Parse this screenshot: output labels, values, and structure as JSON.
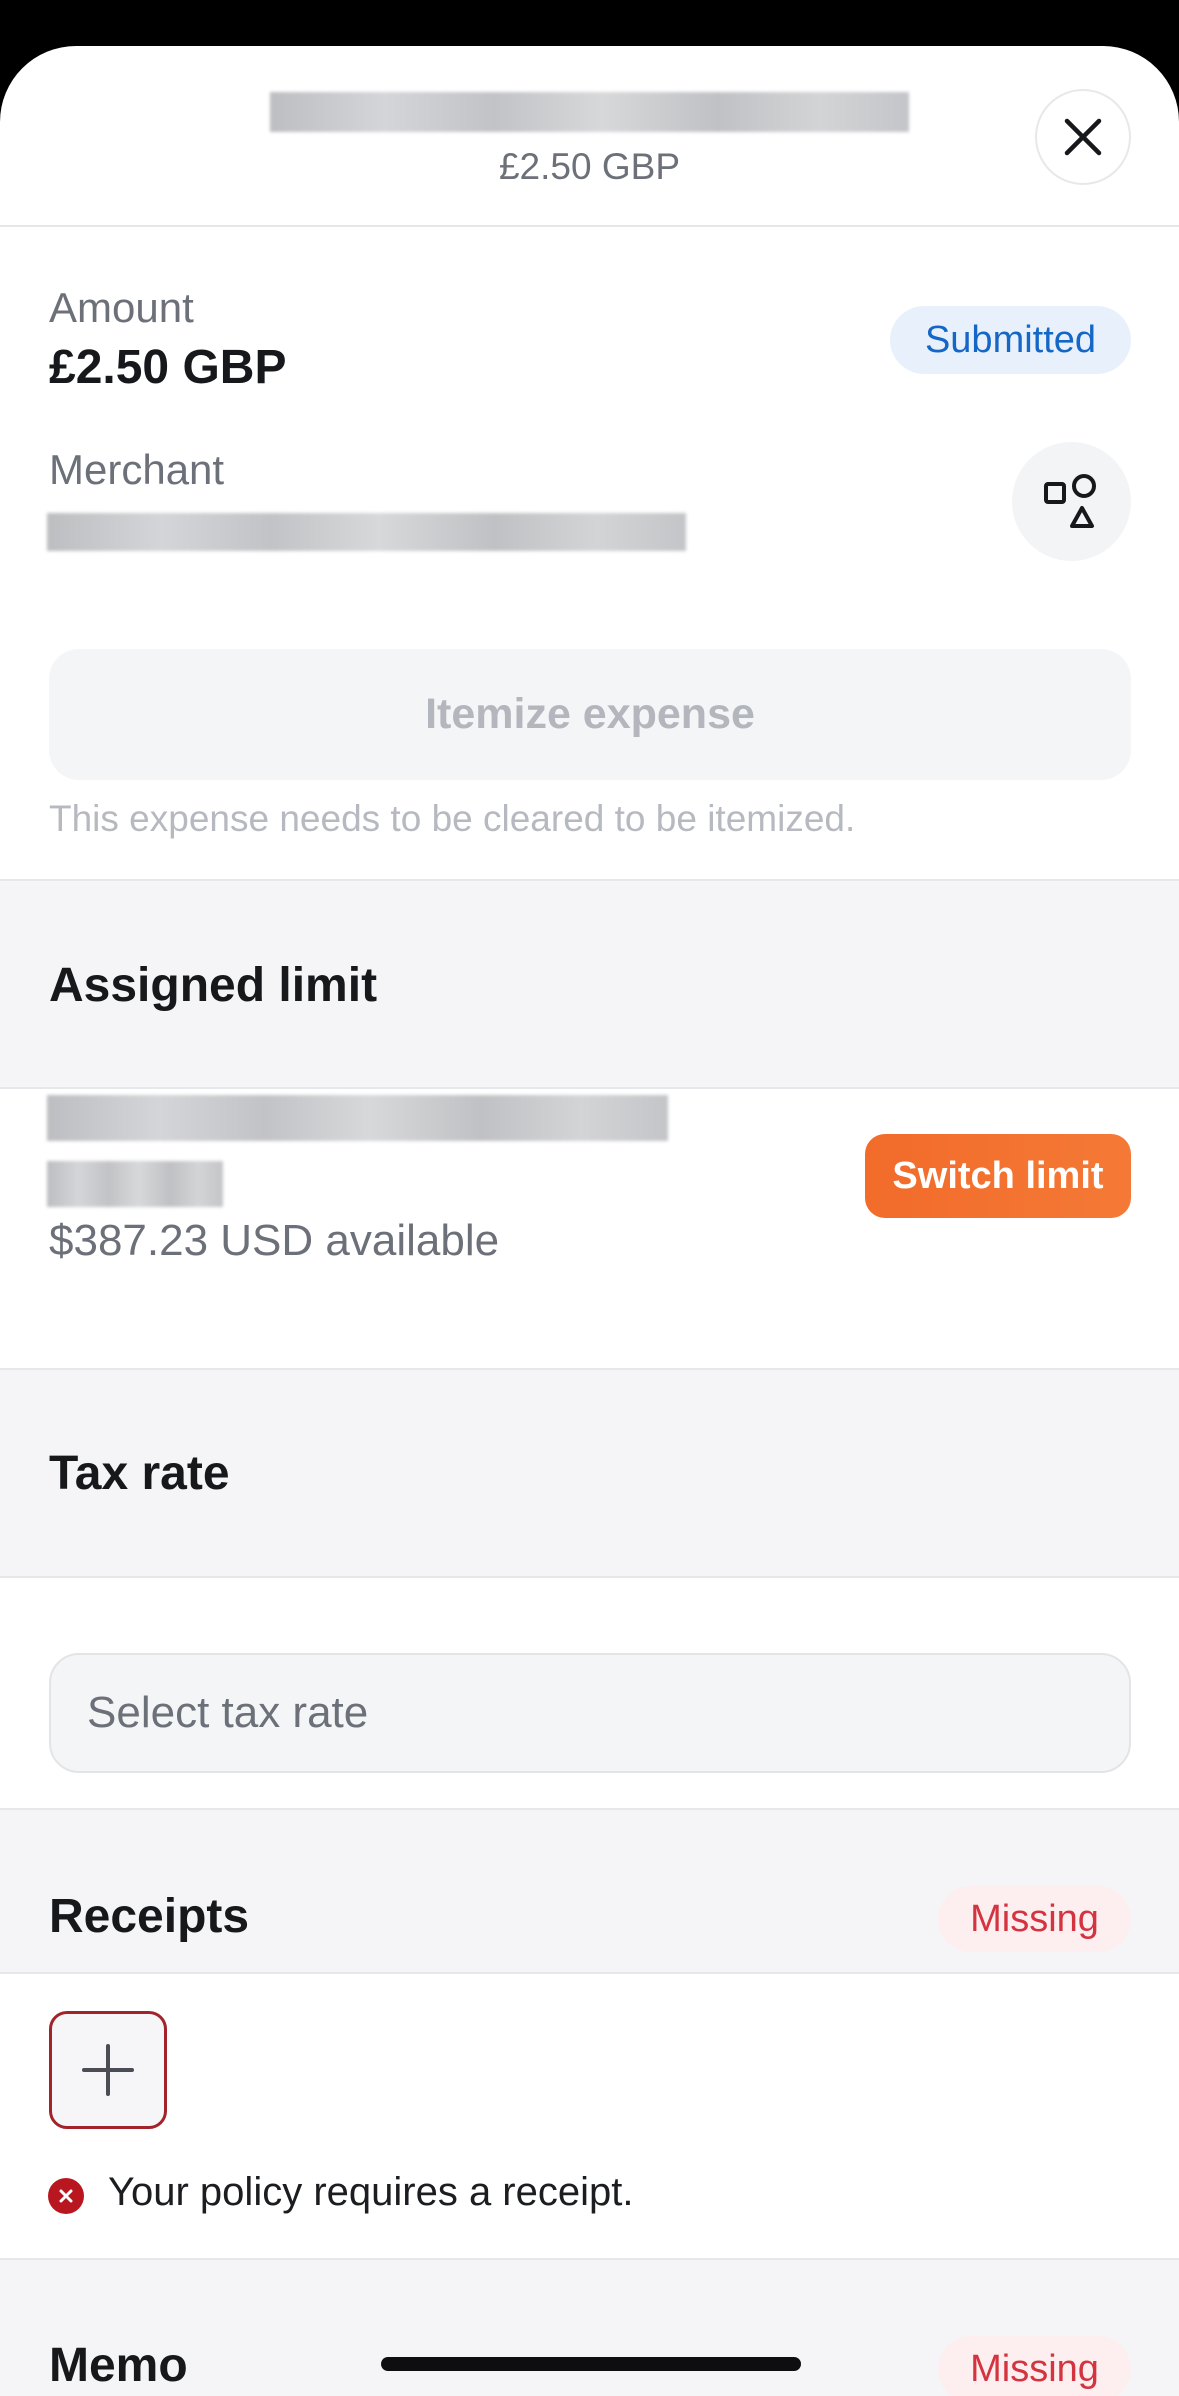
{
  "header": {
    "amount_subtitle": "£2.50 GBP",
    "close_icon": "close-icon"
  },
  "summary": {
    "amount_label": "Amount",
    "amount_value": "£2.50 GBP",
    "status_badge": "Submitted",
    "merchant_label": "Merchant",
    "category_icon": "shapes-icon",
    "itemize_button": "Itemize expense",
    "itemize_note": "This expense needs to be cleared to be itemized."
  },
  "assigned_limit": {
    "title": "Assigned limit",
    "available": "$387.23 USD available",
    "switch_button": "Switch limit"
  },
  "tax_rate": {
    "title": "Tax rate",
    "select_placeholder": "Select tax rate"
  },
  "receipts": {
    "title": "Receipts",
    "status_badge": "Missing",
    "add_icon": "plus-icon",
    "error_icon": "error-x-icon",
    "error_text": "Your policy requires a receipt."
  },
  "memo": {
    "title": "Memo",
    "status_badge": "Missing"
  },
  "colors": {
    "accent_orange": "#f26b2a",
    "status_blue": "#1467c6",
    "missing_red": "#d3343f",
    "error_red": "#b8171f"
  }
}
